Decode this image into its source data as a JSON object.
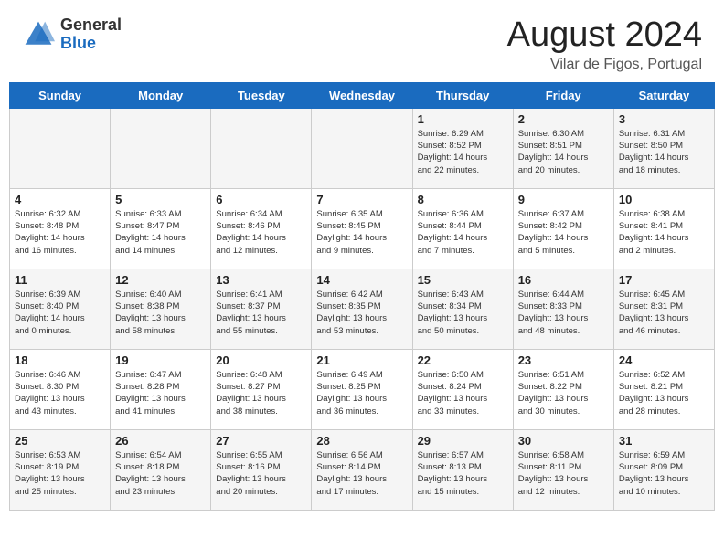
{
  "header": {
    "logo_general": "General",
    "logo_blue": "Blue",
    "month_title": "August 2024",
    "location": "Vilar de Figos, Portugal"
  },
  "days_of_week": [
    "Sunday",
    "Monday",
    "Tuesday",
    "Wednesday",
    "Thursday",
    "Friday",
    "Saturday"
  ],
  "weeks": [
    [
      {
        "day": "",
        "info": ""
      },
      {
        "day": "",
        "info": ""
      },
      {
        "day": "",
        "info": ""
      },
      {
        "day": "",
        "info": ""
      },
      {
        "day": "1",
        "info": "Sunrise: 6:29 AM\nSunset: 8:52 PM\nDaylight: 14 hours\nand 22 minutes."
      },
      {
        "day": "2",
        "info": "Sunrise: 6:30 AM\nSunset: 8:51 PM\nDaylight: 14 hours\nand 20 minutes."
      },
      {
        "day": "3",
        "info": "Sunrise: 6:31 AM\nSunset: 8:50 PM\nDaylight: 14 hours\nand 18 minutes."
      }
    ],
    [
      {
        "day": "4",
        "info": "Sunrise: 6:32 AM\nSunset: 8:48 PM\nDaylight: 14 hours\nand 16 minutes."
      },
      {
        "day": "5",
        "info": "Sunrise: 6:33 AM\nSunset: 8:47 PM\nDaylight: 14 hours\nand 14 minutes."
      },
      {
        "day": "6",
        "info": "Sunrise: 6:34 AM\nSunset: 8:46 PM\nDaylight: 14 hours\nand 12 minutes."
      },
      {
        "day": "7",
        "info": "Sunrise: 6:35 AM\nSunset: 8:45 PM\nDaylight: 14 hours\nand 9 minutes."
      },
      {
        "day": "8",
        "info": "Sunrise: 6:36 AM\nSunset: 8:44 PM\nDaylight: 14 hours\nand 7 minutes."
      },
      {
        "day": "9",
        "info": "Sunrise: 6:37 AM\nSunset: 8:42 PM\nDaylight: 14 hours\nand 5 minutes."
      },
      {
        "day": "10",
        "info": "Sunrise: 6:38 AM\nSunset: 8:41 PM\nDaylight: 14 hours\nand 2 minutes."
      }
    ],
    [
      {
        "day": "11",
        "info": "Sunrise: 6:39 AM\nSunset: 8:40 PM\nDaylight: 14 hours\nand 0 minutes."
      },
      {
        "day": "12",
        "info": "Sunrise: 6:40 AM\nSunset: 8:38 PM\nDaylight: 13 hours\nand 58 minutes."
      },
      {
        "day": "13",
        "info": "Sunrise: 6:41 AM\nSunset: 8:37 PM\nDaylight: 13 hours\nand 55 minutes."
      },
      {
        "day": "14",
        "info": "Sunrise: 6:42 AM\nSunset: 8:35 PM\nDaylight: 13 hours\nand 53 minutes."
      },
      {
        "day": "15",
        "info": "Sunrise: 6:43 AM\nSunset: 8:34 PM\nDaylight: 13 hours\nand 50 minutes."
      },
      {
        "day": "16",
        "info": "Sunrise: 6:44 AM\nSunset: 8:33 PM\nDaylight: 13 hours\nand 48 minutes."
      },
      {
        "day": "17",
        "info": "Sunrise: 6:45 AM\nSunset: 8:31 PM\nDaylight: 13 hours\nand 46 minutes."
      }
    ],
    [
      {
        "day": "18",
        "info": "Sunrise: 6:46 AM\nSunset: 8:30 PM\nDaylight: 13 hours\nand 43 minutes."
      },
      {
        "day": "19",
        "info": "Sunrise: 6:47 AM\nSunset: 8:28 PM\nDaylight: 13 hours\nand 41 minutes."
      },
      {
        "day": "20",
        "info": "Sunrise: 6:48 AM\nSunset: 8:27 PM\nDaylight: 13 hours\nand 38 minutes."
      },
      {
        "day": "21",
        "info": "Sunrise: 6:49 AM\nSunset: 8:25 PM\nDaylight: 13 hours\nand 36 minutes."
      },
      {
        "day": "22",
        "info": "Sunrise: 6:50 AM\nSunset: 8:24 PM\nDaylight: 13 hours\nand 33 minutes."
      },
      {
        "day": "23",
        "info": "Sunrise: 6:51 AM\nSunset: 8:22 PM\nDaylight: 13 hours\nand 30 minutes."
      },
      {
        "day": "24",
        "info": "Sunrise: 6:52 AM\nSunset: 8:21 PM\nDaylight: 13 hours\nand 28 minutes."
      }
    ],
    [
      {
        "day": "25",
        "info": "Sunrise: 6:53 AM\nSunset: 8:19 PM\nDaylight: 13 hours\nand 25 minutes."
      },
      {
        "day": "26",
        "info": "Sunrise: 6:54 AM\nSunset: 8:18 PM\nDaylight: 13 hours\nand 23 minutes."
      },
      {
        "day": "27",
        "info": "Sunrise: 6:55 AM\nSunset: 8:16 PM\nDaylight: 13 hours\nand 20 minutes."
      },
      {
        "day": "28",
        "info": "Sunrise: 6:56 AM\nSunset: 8:14 PM\nDaylight: 13 hours\nand 17 minutes."
      },
      {
        "day": "29",
        "info": "Sunrise: 6:57 AM\nSunset: 8:13 PM\nDaylight: 13 hours\nand 15 minutes."
      },
      {
        "day": "30",
        "info": "Sunrise: 6:58 AM\nSunset: 8:11 PM\nDaylight: 13 hours\nand 12 minutes."
      },
      {
        "day": "31",
        "info": "Sunrise: 6:59 AM\nSunset: 8:09 PM\nDaylight: 13 hours\nand 10 minutes."
      }
    ]
  ]
}
